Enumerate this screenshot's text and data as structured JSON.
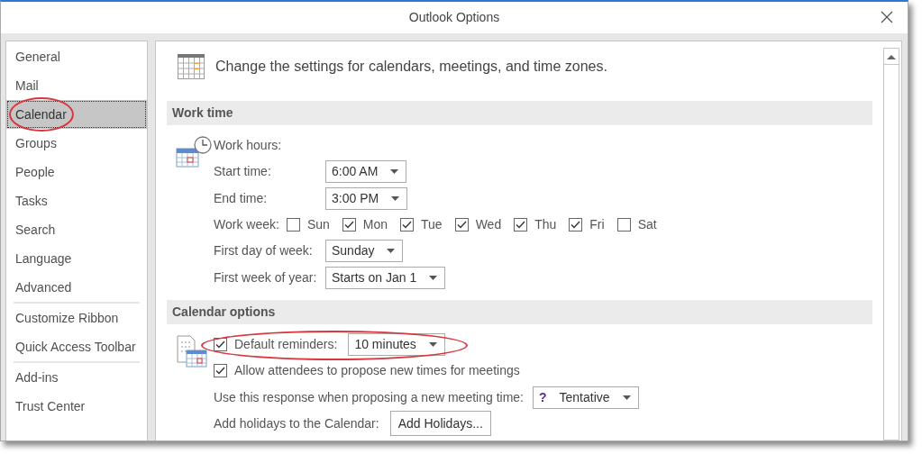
{
  "window": {
    "title": "Outlook Options"
  },
  "sidebar": {
    "groups": [
      [
        {
          "label": "General",
          "selected": false,
          "circled": false
        },
        {
          "label": "Mail",
          "selected": false,
          "circled": false
        },
        {
          "label": "Calendar",
          "selected": true,
          "circled": true
        },
        {
          "label": "Groups",
          "selected": false,
          "circled": false
        },
        {
          "label": "People",
          "selected": false,
          "circled": false
        },
        {
          "label": "Tasks",
          "selected": false,
          "circled": false
        },
        {
          "label": "Search",
          "selected": false,
          "circled": false
        },
        {
          "label": "Language",
          "selected": false,
          "circled": false
        },
        {
          "label": "Advanced",
          "selected": false,
          "circled": false
        }
      ],
      [
        {
          "label": "Customize Ribbon",
          "selected": false,
          "circled": false
        },
        {
          "label": "Quick Access Toolbar",
          "selected": false,
          "circled": false
        }
      ],
      [
        {
          "label": "Add-ins",
          "selected": false,
          "circled": false
        },
        {
          "label": "Trust Center",
          "selected": false,
          "circled": false
        }
      ]
    ]
  },
  "header": {
    "text": "Change the settings for calendars, meetings, and time zones."
  },
  "sections": [
    {
      "title": "Work time",
      "rows": [
        {
          "kind": "label",
          "label": "Work hours:"
        },
        {
          "kind": "dropdown",
          "label": "Start time:",
          "value": "6:00 AM"
        },
        {
          "kind": "dropdown",
          "label": "End time:",
          "value": "3:00 PM"
        },
        {
          "kind": "days",
          "label": "Work week:",
          "days": [
            {
              "label": "Sun",
              "checked": false
            },
            {
              "label": "Mon",
              "checked": true
            },
            {
              "label": "Tue",
              "checked": true
            },
            {
              "label": "Wed",
              "checked": true
            },
            {
              "label": "Thu",
              "checked": true
            },
            {
              "label": "Fri",
              "checked": true
            },
            {
              "label": "Sat",
              "checked": false
            }
          ]
        },
        {
          "kind": "dropdown",
          "label": "First day of week:",
          "value": "Sunday"
        },
        {
          "kind": "dropdown",
          "label": "First week of year:",
          "value": "Starts on Jan 1"
        }
      ]
    },
    {
      "title": "Calendar options",
      "rows": [
        {
          "kind": "checkbox_dropdown",
          "label": "Default reminders:",
          "checked": true,
          "value": "10 minutes",
          "circled": true
        },
        {
          "kind": "checkbox",
          "label": "Allow attendees to propose new times for meetings",
          "checked": true
        },
        {
          "kind": "inline_dropdown",
          "label": "Use this response when proposing a new meeting time:",
          "prefix": "?",
          "value": "Tentative"
        },
        {
          "kind": "button",
          "label": "Add holidays to the Calendar:",
          "button": "Add Holidays..."
        }
      ]
    }
  ]
}
